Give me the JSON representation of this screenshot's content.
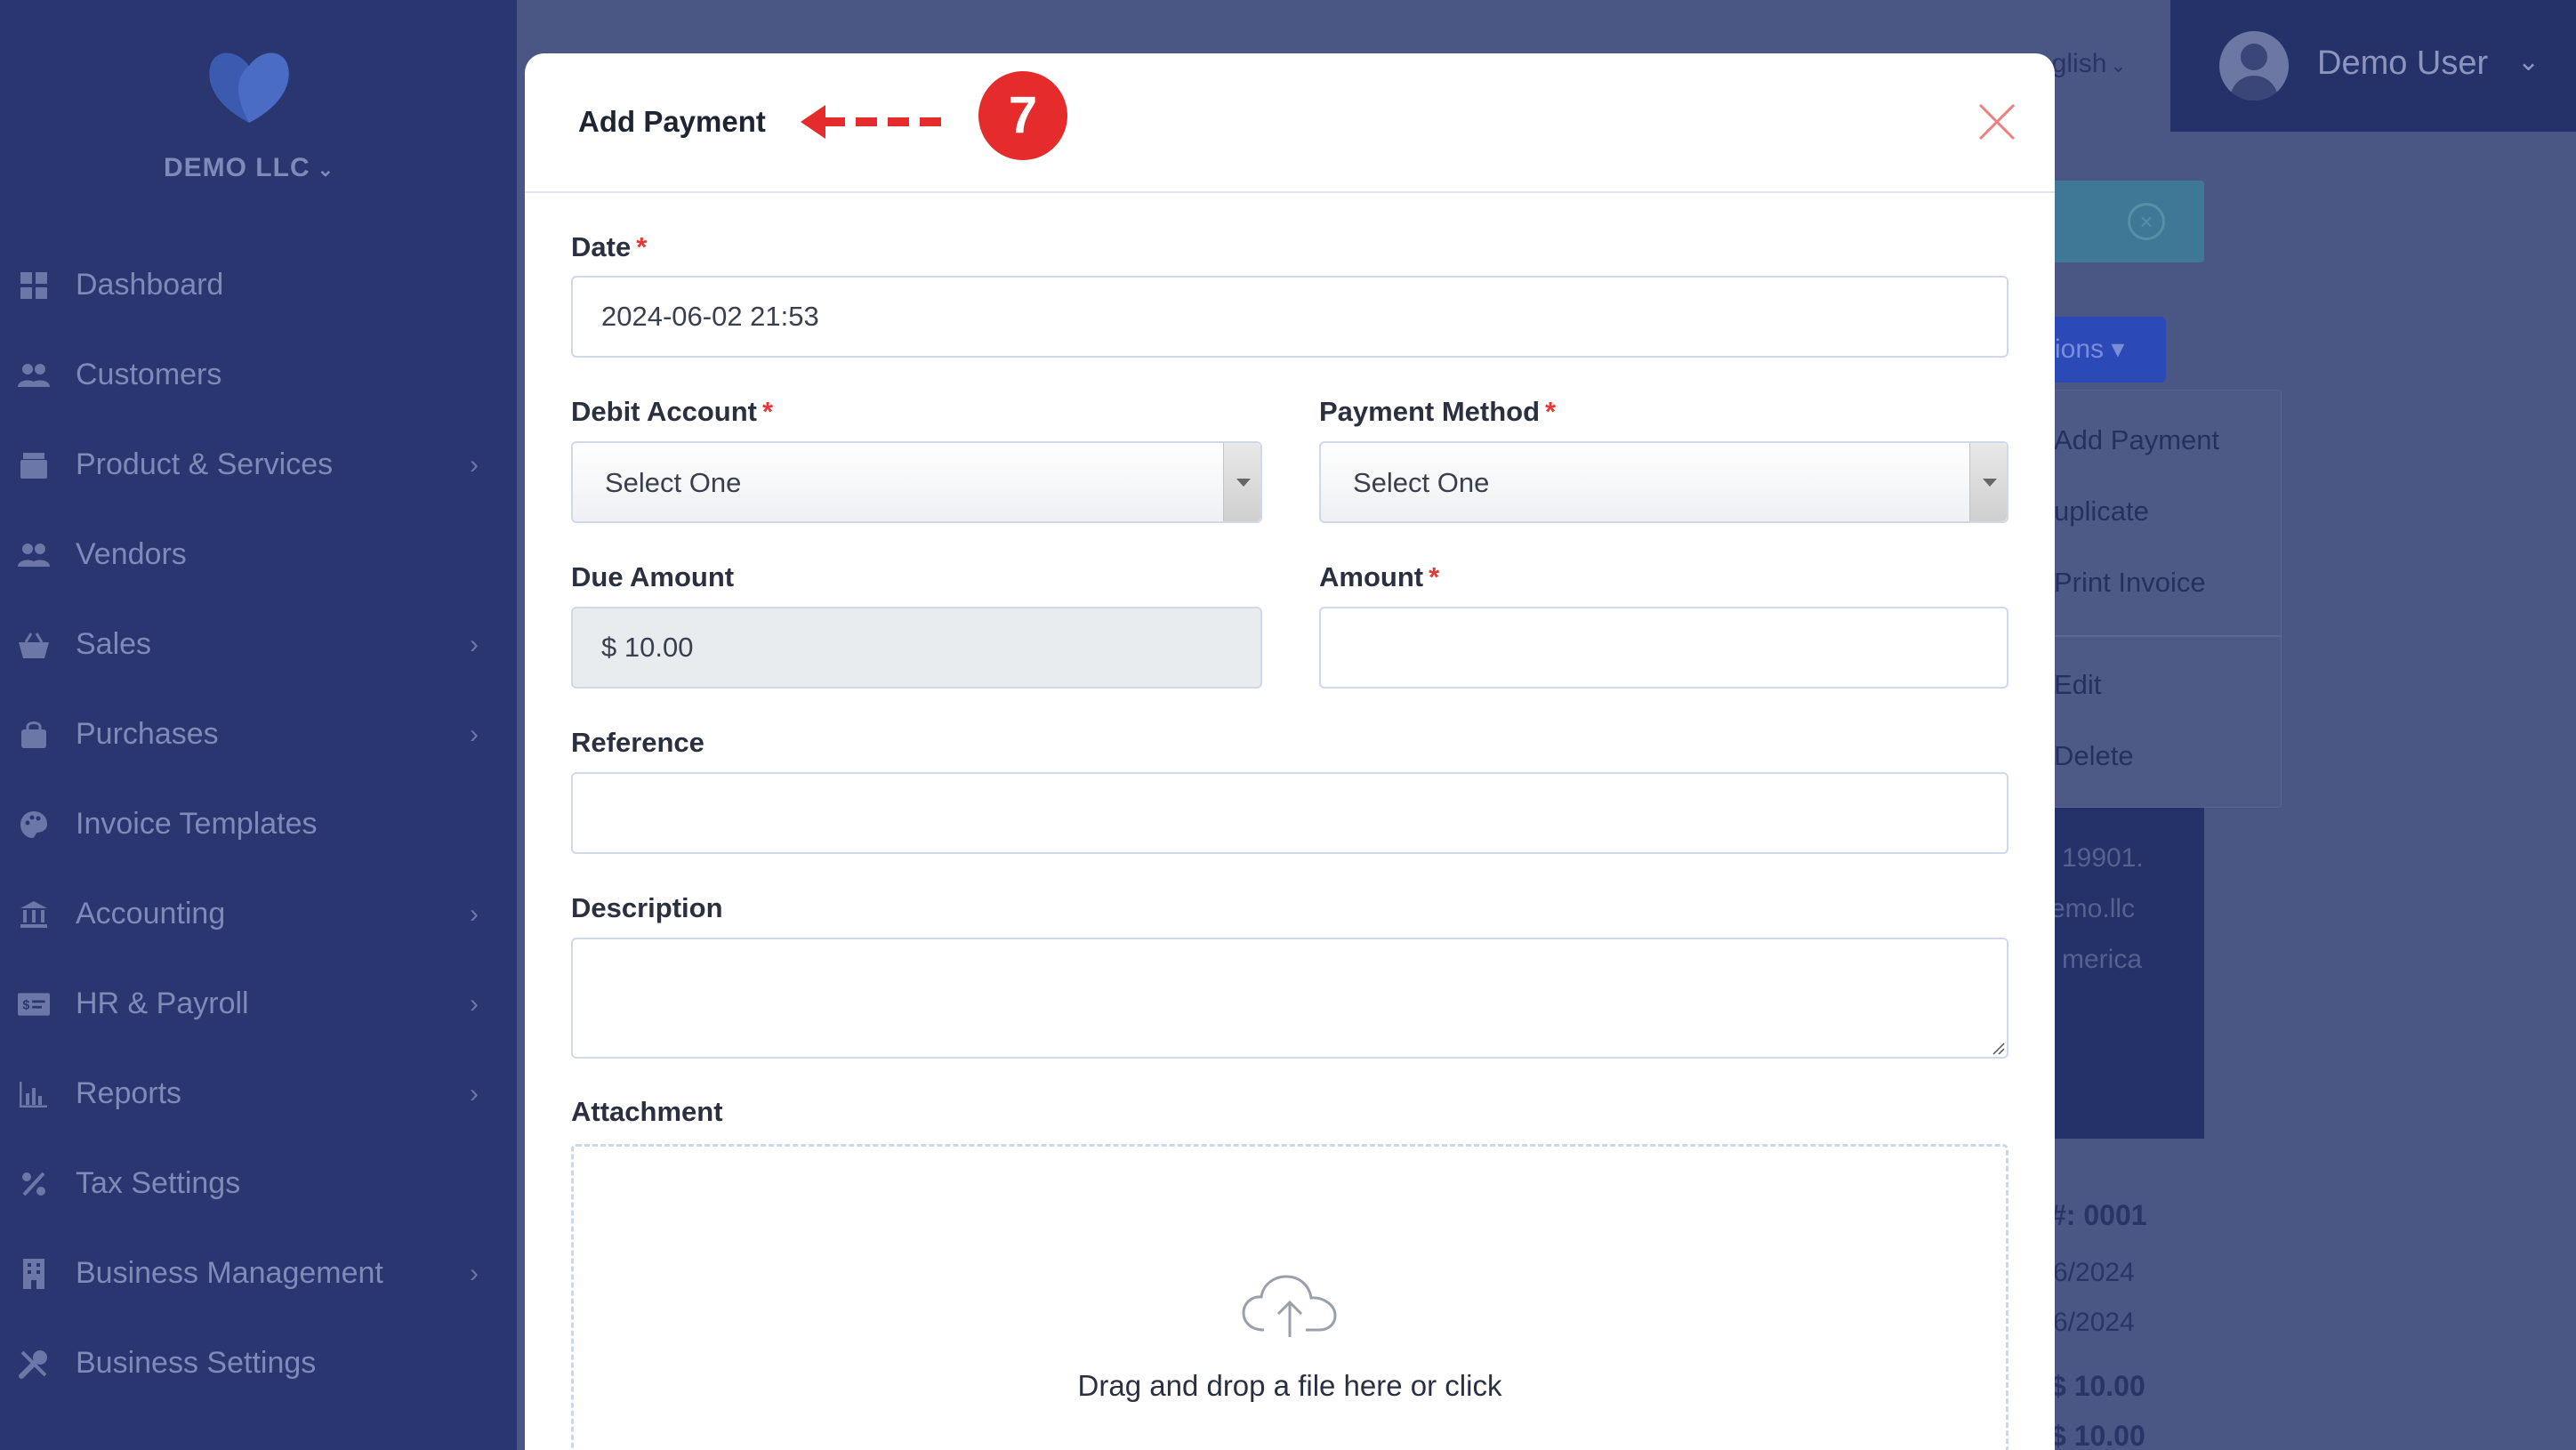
{
  "sidebar": {
    "company": "DEMO LLC",
    "items": [
      {
        "label": "Dashboard",
        "icon": "dashboard-icon",
        "has_submenu": false
      },
      {
        "label": "Customers",
        "icon": "users-icon",
        "has_submenu": false
      },
      {
        "label": "Product & Services",
        "icon": "box-icon",
        "has_submenu": true
      },
      {
        "label": "Vendors",
        "icon": "users-icon",
        "has_submenu": false
      },
      {
        "label": "Sales",
        "icon": "basket-icon",
        "has_submenu": true
      },
      {
        "label": "Purchases",
        "icon": "bag-icon",
        "has_submenu": true
      },
      {
        "label": "Invoice Templates",
        "icon": "palette-icon",
        "has_submenu": false
      },
      {
        "label": "Accounting",
        "icon": "bank-icon",
        "has_submenu": true
      },
      {
        "label": "HR & Payroll",
        "icon": "money-icon",
        "has_submenu": true
      },
      {
        "label": "Reports",
        "icon": "chart-icon",
        "has_submenu": true
      },
      {
        "label": "Tax Settings",
        "icon": "percent-icon",
        "has_submenu": false
      },
      {
        "label": "Business Management",
        "icon": "building-icon",
        "has_submenu": true
      },
      {
        "label": "Business Settings",
        "icon": "tools-icon",
        "has_submenu": false
      }
    ]
  },
  "topbar": {
    "language": "nglish",
    "user_name": "Demo User"
  },
  "background": {
    "actions_label": "ions",
    "dropdown": [
      "Add Payment",
      "uplicate",
      "Print Invoice",
      "Edit",
      "Delete"
    ],
    "address_lines": [
      "19901.",
      "emo.llc",
      "merica"
    ],
    "invoice_lines": [
      "#: 0001",
      "6/2024",
      "6/2024",
      "$ 10.00",
      "$ 10.00"
    ]
  },
  "modal": {
    "title": "Add Payment",
    "annotation_step": "7",
    "fields": {
      "date": {
        "label": "Date",
        "required": "*",
        "value": "2024-06-02 21:53"
      },
      "debit_account": {
        "label": "Debit Account",
        "required": "*",
        "value": "Select One"
      },
      "payment_method": {
        "label": "Payment Method",
        "required": "*",
        "value": "Select One"
      },
      "due_amount": {
        "label": "Due Amount",
        "value": "$ 10.00"
      },
      "amount": {
        "label": "Amount",
        "required": "*",
        "value": ""
      },
      "reference": {
        "label": "Reference",
        "value": ""
      },
      "description": {
        "label": "Description",
        "value": ""
      },
      "attachment": {
        "label": "Attachment",
        "dropzone_text": "Drag and drop a file here or click"
      }
    }
  },
  "colors": {
    "sidebar_bg": "#2a3670",
    "overlay_bg": "#4a5684",
    "annotation_red": "#e52b2b",
    "required_red": "#e53935"
  }
}
